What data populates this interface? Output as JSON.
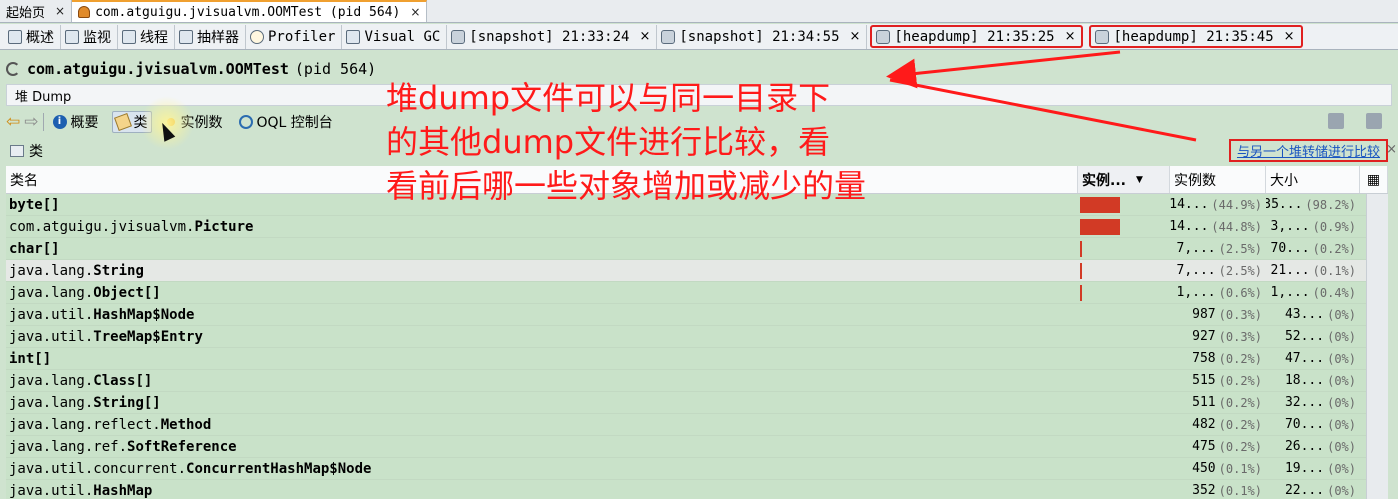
{
  "document_tabs": [
    {
      "label": "起始页",
      "active": false
    },
    {
      "label": "com.atguigu.jvisualvm.OOMTest (pid 564)",
      "active": true
    }
  ],
  "view_tabs": [
    {
      "label": "概述",
      "icon": "overview-icon",
      "close": ""
    },
    {
      "label": "监视",
      "icon": "monitor-icon",
      "close": ""
    },
    {
      "label": "线程",
      "icon": "threads-icon",
      "close": ""
    },
    {
      "label": "抽样器",
      "icon": "sampler-icon",
      "close": ""
    },
    {
      "label": "Profiler",
      "icon": "profiler-icon",
      "close": ""
    },
    {
      "label": "Visual GC",
      "icon": "visual-gc-icon",
      "close": ""
    },
    {
      "label": "[snapshot] 21:33:24",
      "icon": "snapshot-icon",
      "close": "×"
    },
    {
      "label": "[snapshot] 21:34:55",
      "icon": "snapshot-icon",
      "close": "×"
    },
    {
      "label": "[heapdump] 21:35:25",
      "icon": "heapdump-icon",
      "close": "×"
    },
    {
      "label": "[heapdump] 21:35:45",
      "icon": "heapdump-icon",
      "close": "×"
    }
  ],
  "app_title": {
    "main": "com.atguigu.jvisualvm.OOMTest",
    "pid": "(pid 564)"
  },
  "subtab": "堆 Dump",
  "toolbar": {
    "overview": "概要",
    "classes": "类",
    "instances": "实例数",
    "oql": "OQL 控制台"
  },
  "panel": {
    "title": "类",
    "compare_link": "与另一个堆转储进行比较",
    "close": "×"
  },
  "table": {
    "headers": {
      "name": "类名",
      "bar": "实例...",
      "count": "实例数",
      "size": "大小"
    },
    "rows": [
      {
        "pre": "",
        "bold": "byte[]",
        "bar": 0.449,
        "count": "14...",
        "count_pct": "(44.9%)",
        "size": "35...",
        "size_pct": "(98.2%)"
      },
      {
        "pre": "com.atguigu.jvisualvm.",
        "bold": "Picture",
        "bar": 0.448,
        "count": "14...",
        "count_pct": "(44.8%)",
        "size": "3,...",
        "size_pct": "(0.9%)"
      },
      {
        "pre": "",
        "bold": "char[]",
        "bar": 0.025,
        "count": "7,...",
        "count_pct": "(2.5%)",
        "size": "70...",
        "size_pct": "(0.2%)"
      },
      {
        "pre": "java.lang.",
        "bold": "String",
        "bar": 0.025,
        "count": "7,...",
        "count_pct": "(2.5%)",
        "size": "21...",
        "size_pct": "(0.1%)"
      },
      {
        "pre": "java.lang.",
        "bold": "Object[]",
        "bar": 0.006,
        "count": "1,...",
        "count_pct": "(0.6%)",
        "size": "1,...",
        "size_pct": "(0.4%)"
      },
      {
        "pre": "java.util.",
        "bold": "HashMap$Node",
        "bar": 0.003,
        "count": "987",
        "count_pct": "(0.3%)",
        "size": "43...",
        "size_pct": "(0%)"
      },
      {
        "pre": "java.util.",
        "bold": "TreeMap$Entry",
        "bar": 0.003,
        "count": "927",
        "count_pct": "(0.3%)",
        "size": "52...",
        "size_pct": "(0%)"
      },
      {
        "pre": "",
        "bold": "int[]",
        "bar": 0.002,
        "count": "758",
        "count_pct": "(0.2%)",
        "size": "47...",
        "size_pct": "(0%)"
      },
      {
        "pre": "java.lang.",
        "bold": "Class[]",
        "bar": 0.002,
        "count": "515",
        "count_pct": "(0.2%)",
        "size": "18...",
        "size_pct": "(0%)"
      },
      {
        "pre": "java.lang.",
        "bold": "String[]",
        "bar": 0.002,
        "count": "511",
        "count_pct": "(0.2%)",
        "size": "32...",
        "size_pct": "(0%)"
      },
      {
        "pre": "java.lang.reflect.",
        "bold": "Method",
        "bar": 0.002,
        "count": "482",
        "count_pct": "(0.2%)",
        "size": "70...",
        "size_pct": "(0%)"
      },
      {
        "pre": "java.lang.ref.",
        "bold": "SoftReference",
        "bar": 0.002,
        "count": "475",
        "count_pct": "(0.2%)",
        "size": "26...",
        "size_pct": "(0%)"
      },
      {
        "pre": "java.util.concurrent.",
        "bold": "ConcurrentHashMap$Node",
        "bar": 0.001,
        "count": "450",
        "count_pct": "(0.1%)",
        "size": "19...",
        "size_pct": "(0%)"
      },
      {
        "pre": "java.util.",
        "bold": "HashMap",
        "bar": 0.001,
        "count": "352",
        "count_pct": "(0.1%)",
        "size": "22...",
        "size_pct": "(0%)"
      }
    ]
  },
  "annotation": {
    "line1": "堆dump文件可以与同一目录下",
    "line2": "的其他dump文件进行比较，看",
    "line3": "看前后哪一些对象增加或减少的量"
  },
  "colors": {
    "bar": "#d23a25",
    "highlight": "#e02020",
    "annotation": "#ff1a1a",
    "row_bg": "#c9e2c9"
  }
}
